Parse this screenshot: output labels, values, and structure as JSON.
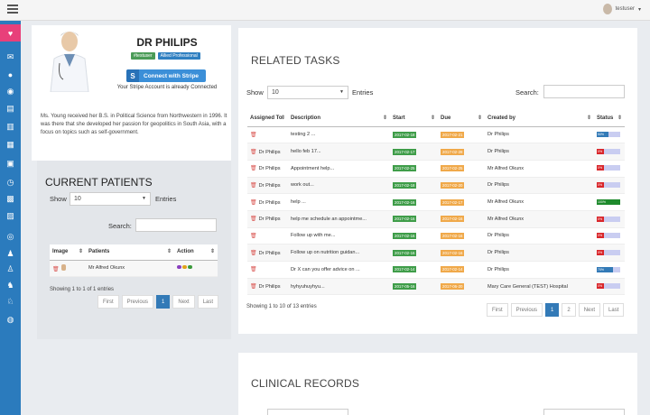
{
  "topbar": {
    "user": "testuser"
  },
  "sidebar": {
    "items": [
      "home-icon",
      "chat-icon",
      "comment-icon",
      "comments-icon",
      "file-icon",
      "file-text-icon",
      "file-alt-icon",
      "calendar-icon",
      "clock-icon",
      "calendar-check-icon",
      "calendar-alt-icon",
      "eye-icon",
      "user-icon",
      "user-md-icon",
      "user-plus-icon",
      "user-circle-icon",
      "globe-icon"
    ],
    "active_index": 0
  },
  "profile": {
    "name": "DR PHILIPS",
    "badges": [
      {
        "label": "#testuser",
        "color": "#4a9b57"
      },
      {
        "label": "Allied Professional",
        "color": "#2f7fc1"
      }
    ],
    "stripe_button": "Connect with Stripe",
    "stripe_icon": "S",
    "stripe_note": "Your Stripe Account is already Connected",
    "bio": "Ms. Young received her B.S. in Political Science from Northwestern in 1996. It was there that she developed her passion for geopolitics in South Asia, with a focus on topics such as self-government."
  },
  "patients": {
    "title": "CURRENT PATIENTS",
    "show_label": "Show",
    "show_value": "10",
    "entries_label": "Entries",
    "search_label": "Search:",
    "columns": [
      "Image",
      "Patients",
      "Action"
    ],
    "rows": [
      {
        "name": "Mr Alfred Okunx"
      }
    ],
    "info": "Showing 1 to 1 of 1 entries",
    "pager": [
      "First",
      "Previous",
      "1",
      "Next",
      "Last"
    ]
  },
  "tasks": {
    "title": "RELATED TASKS",
    "show_label": "Show",
    "show_value": "10",
    "entries_label": "Entries",
    "search_label": "Search:",
    "columns": [
      "Assigned To",
      "Description",
      "Start",
      "Due",
      "Created by",
      "Status"
    ],
    "rows": [
      {
        "assigned": "",
        "desc": "testing 2 ...",
        "start": "2017-02-18",
        "due": "2017-02-21",
        "created": "Dr Philips",
        "status": 50
      },
      {
        "assigned": "Dr Philips",
        "desc": "hello feb 17...",
        "start": "2017-02-17",
        "due": "2017-02-28",
        "created": "Dr Philips",
        "status": 0
      },
      {
        "assigned": "Dr Philips",
        "desc": "Appointment help...",
        "start": "2017-02-25",
        "due": "2017-02-25",
        "created": "Mr Alfred Okunx",
        "status": 0
      },
      {
        "assigned": "Dr Philips",
        "desc": "work out...",
        "start": "2017-02-18",
        "due": "2017-02-20",
        "created": "Dr Philips",
        "status": 0
      },
      {
        "assigned": "Dr Philips",
        "desc": "help ...",
        "start": "2017-02-16",
        "due": "2017-02-17",
        "created": "Mr Alfred Okunx",
        "status": 100
      },
      {
        "assigned": "Dr Philips",
        "desc": "help me schedule an appointme...",
        "start": "2017-02-16",
        "due": "2017-02-16",
        "created": "Mr Alfred Okunx",
        "status": 0
      },
      {
        "assigned": "",
        "desc": "Follow up with me...",
        "start": "2017-02-16",
        "due": "2017-02-16",
        "created": "Dr Philips",
        "status": 0
      },
      {
        "assigned": "Dr Philips",
        "desc": "Follow up on nutrition guidan...",
        "start": "2017-02-16",
        "due": "2017-02-16",
        "created": "Dr Philips",
        "status": 0
      },
      {
        "assigned": "",
        "desc": "Dr X can you offer advice on ...",
        "start": "2017-02-14",
        "due": "2017-02-14",
        "created": "Dr Philips",
        "status": 70
      },
      {
        "assigned": "Dr Philips",
        "desc": "hyhyuhuyhyu...",
        "start": "2017-05-16",
        "due": "2017-06-20",
        "created": "Mary Care General (TEST) Hospital",
        "status": 0
      }
    ],
    "info": "Showing 1 to 10 of 13 entries",
    "pager": [
      "First",
      "Previous",
      "1",
      "2",
      "Next",
      "Last"
    ]
  },
  "clinical": {
    "title": "CLINICAL RECORDS"
  },
  "colors": {
    "sidebar": "#2b7bbd",
    "sidebar_active": "#e8407a",
    "date_green": "#3f9d49",
    "date_orange": "#f0a94a",
    "progress_blue": "#337ab7",
    "progress_green": "#1e8a2c",
    "progress_red": "#d9262b",
    "pager_active": "#337ab7"
  }
}
